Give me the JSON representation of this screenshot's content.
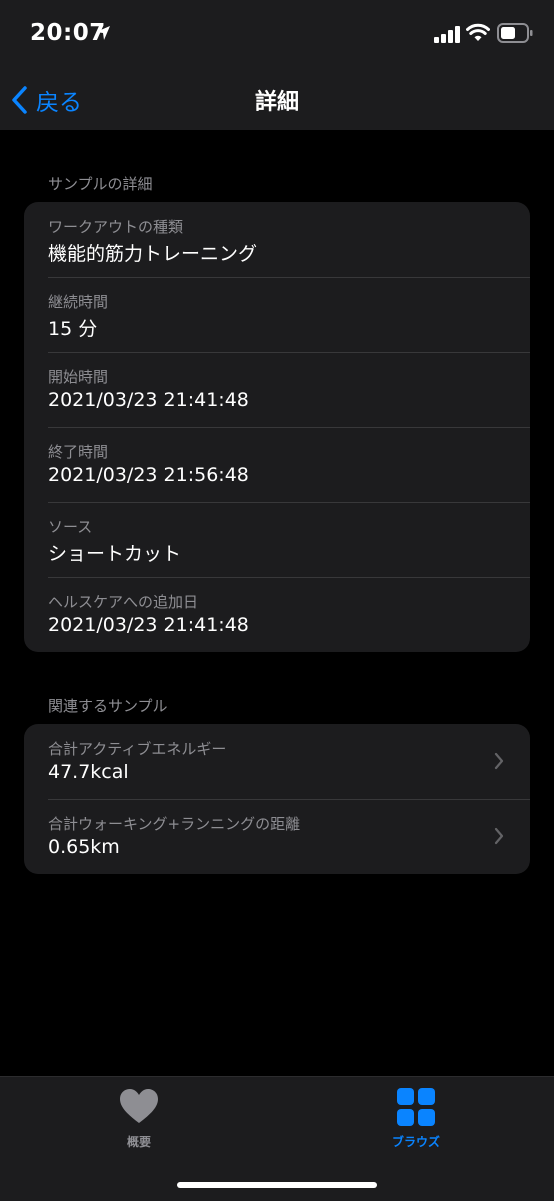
{
  "status_bar": {
    "time": "20:07"
  },
  "nav": {
    "back_label": "戻る",
    "title": "詳細"
  },
  "sample_details": {
    "header": "サンプルの詳細",
    "rows": [
      {
        "label": "ワークアウトの種類",
        "value": "機能的筋力トレーニング"
      },
      {
        "label": "継続時間",
        "value": "15 分"
      },
      {
        "label": "開始時間",
        "value": "2021/03/23 21:41:48"
      },
      {
        "label": "終了時間",
        "value": "2021/03/23 21:56:48"
      },
      {
        "label": "ソース",
        "value": "ショートカット"
      },
      {
        "label": "ヘルスケアへの追加日",
        "value": "2021/03/23 21:41:48"
      }
    ]
  },
  "related_samples": {
    "header": "関連するサンプル",
    "rows": [
      {
        "label": "合計アクティブエネルギー",
        "value": "47.7kcal"
      },
      {
        "label": "合計ウォーキング+ランニングの距離",
        "value": "0.65km"
      }
    ]
  },
  "tab_bar": {
    "summary_label": "概要",
    "browse_label": "ブラウズ",
    "summary_icon": "heart-icon",
    "browse_icon": "grid-icon",
    "active_color": "#0a84ff",
    "inactive_color": "#8e8e93"
  }
}
